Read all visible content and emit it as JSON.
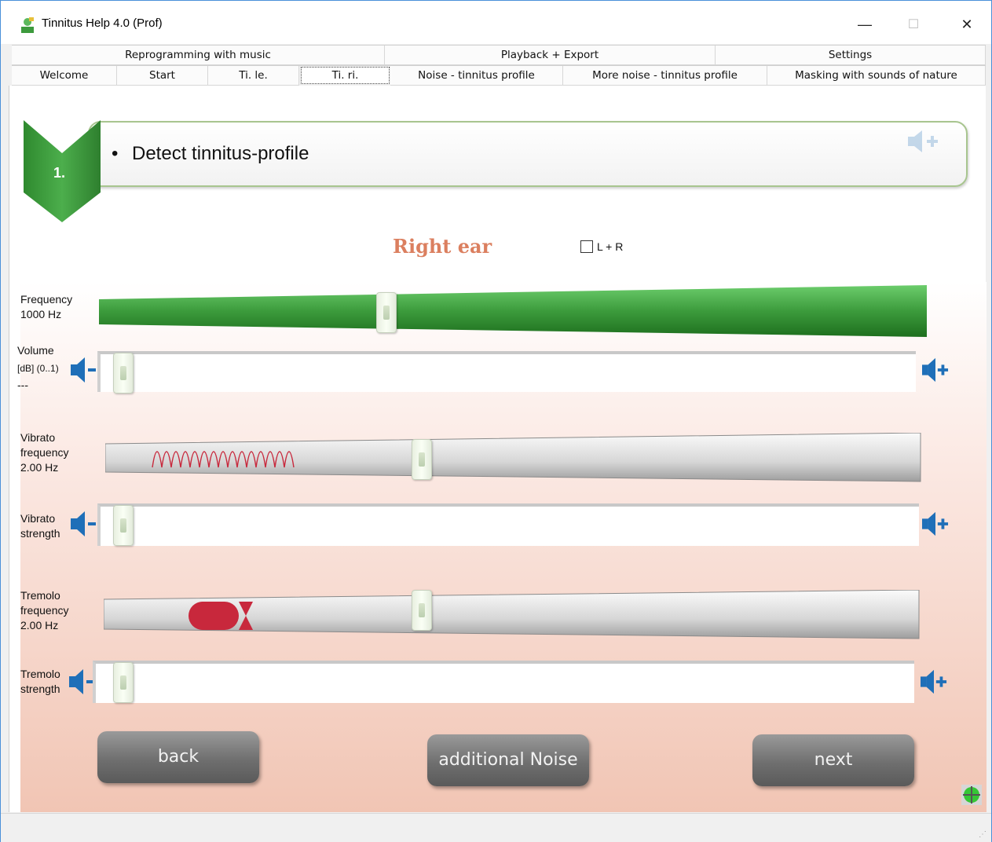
{
  "window": {
    "title": "Tinnitus Help 4.0 (Prof)",
    "minimize_glyph": "—",
    "maximize_glyph": "☐",
    "close_glyph": "✕"
  },
  "tabs_top": [
    {
      "label": "Reprogramming with music"
    },
    {
      "label": "Playback + Export"
    },
    {
      "label": "Settings"
    }
  ],
  "tabs_bottom": [
    {
      "label": "Welcome"
    },
    {
      "label": "Start"
    },
    {
      "label": "Ti. le."
    },
    {
      "label": "Ti. ri.",
      "active": true
    },
    {
      "label": "Noise - tinnitus profile"
    },
    {
      "label": "More noise - tinnitus profile"
    },
    {
      "label": "Masking with sounds of nature"
    }
  ],
  "step": {
    "number": "1.",
    "bullet": "•",
    "text": "Detect tinnitus-profile"
  },
  "ear": {
    "label": "Right ear",
    "lr_label": "L + R",
    "lr_checked": false
  },
  "controls": {
    "frequency": {
      "label1": "Frequency",
      "label2": "1000 Hz",
      "position": 0.35
    },
    "volume": {
      "label1": "Volume",
      "label2": "[dB] (0..1)",
      "label3": "---",
      "position": 0.0
    },
    "vibrato_frequency": {
      "label1": "Vibrato",
      "label2": "frequency",
      "label3": "2.00 Hz",
      "position": 0.39
    },
    "vibrato_strength": {
      "label1": "Vibrato",
      "label2": "strength",
      "position": 0.0
    },
    "tremolo_frequency": {
      "label1": "Tremolo",
      "label2": "frequency",
      "label3": "2.00 Hz",
      "position": 0.39
    },
    "tremolo_strength": {
      "label1": "Tremolo",
      "label2": "strength",
      "position": 0.0
    }
  },
  "buttons": {
    "back": "back",
    "additional_noise": "additional Noise",
    "next": "next"
  },
  "colors": {
    "accent_green": "#3d9a3d",
    "speaker_blue": "#1f6fb8",
    "ear_label": "#db7f5f",
    "wave_red": "#c8283c"
  }
}
